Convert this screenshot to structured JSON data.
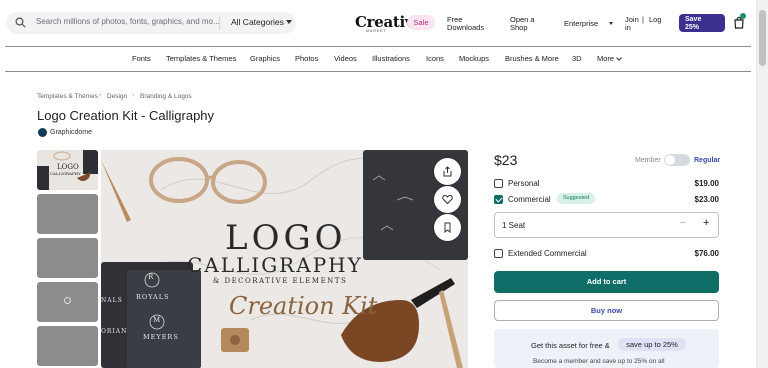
{
  "header": {
    "search_placeholder": "Search millions of photos, fonts, graphics, and mo...",
    "category_select": "All Categories",
    "logo": "Creative",
    "logo_sub": "MARKET",
    "sale": "Sale",
    "free_downloads_l1": "Free",
    "free_downloads_l2": "Downloads",
    "open_shop_l1": "Open a",
    "open_shop_l2": "Shop",
    "enterprise": "Enterprise",
    "join": "Join",
    "sep": "|",
    "log": "Log",
    "login_in": "in",
    "save_l1": "Save",
    "save_l2": "25%"
  },
  "categories": [
    "Fonts",
    "Templates & Themes",
    "Graphics",
    "Photos",
    "Videos",
    "Illustrations",
    "Icons",
    "Mockups",
    "Brushes & More",
    "3D",
    "More"
  ],
  "breadcrumb": [
    "Templates & Themes",
    "Design",
    "Branding & Logos"
  ],
  "product": {
    "title": "Logo Creation Kit - Calligraphy",
    "author": "Graphicdome",
    "image_words": {
      "logo": "LOGO",
      "calligraphy": "CALLIGRAPHY",
      "decorative": "& DECORATIVE ELEMENTS",
      "creation": "Creation Kit",
      "royals": "ROYALS",
      "meyers": "MEYERS",
      "r": "R",
      "m": "M",
      "nals": "NALS",
      "orian": "ORIAN",
      "thumb_logo": "LOGO",
      "thumb_calligraphy": "CALLIGRAPHY"
    }
  },
  "purchase": {
    "price": "$23",
    "member_label": "Member",
    "regular_label": "Regular",
    "options": [
      {
        "label": "Personal",
        "price": "$19.00",
        "checked": false
      },
      {
        "label": "Commercial",
        "price": "$23.00",
        "checked": true,
        "badge": "Suggested"
      },
      {
        "label": "Extended Commercial",
        "price": "$76.00",
        "checked": false
      }
    ],
    "seats": "1 Seat",
    "minus": "−",
    "plus": "+",
    "add_to_cart": "Add to cart",
    "buy_now": "Buy now",
    "promo_l1": "Get this asset for free &",
    "promo_highlight": "save up to 25%",
    "promo_l2": "Become a member and save up to 25% on all"
  },
  "colors": {
    "accent_teal": "#0f6e67",
    "save_purple": "#3b2f8f",
    "link_blue": "#3b4aa8",
    "sale_pink": "#b5307a"
  }
}
